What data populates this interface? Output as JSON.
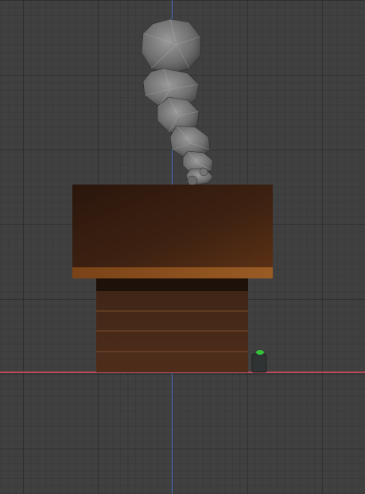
{
  "viewport": {
    "background_color": "#404040",
    "grid_color": "#353535",
    "x_axis_color": "#b64a5a",
    "y_axis_color": "#4d79c7"
  },
  "scene": {
    "objects": [
      {
        "name": "chimney-block",
        "color": "#4a2612"
      },
      {
        "name": "chimney-ledge",
        "color": "#8a4f20"
      },
      {
        "name": "chimney-base",
        "color": "#4d2c1c"
      },
      {
        "name": "smoke-plume",
        "color": "#7b7b7b"
      },
      {
        "name": "green-marker",
        "color": "#35c23a"
      }
    ]
  }
}
